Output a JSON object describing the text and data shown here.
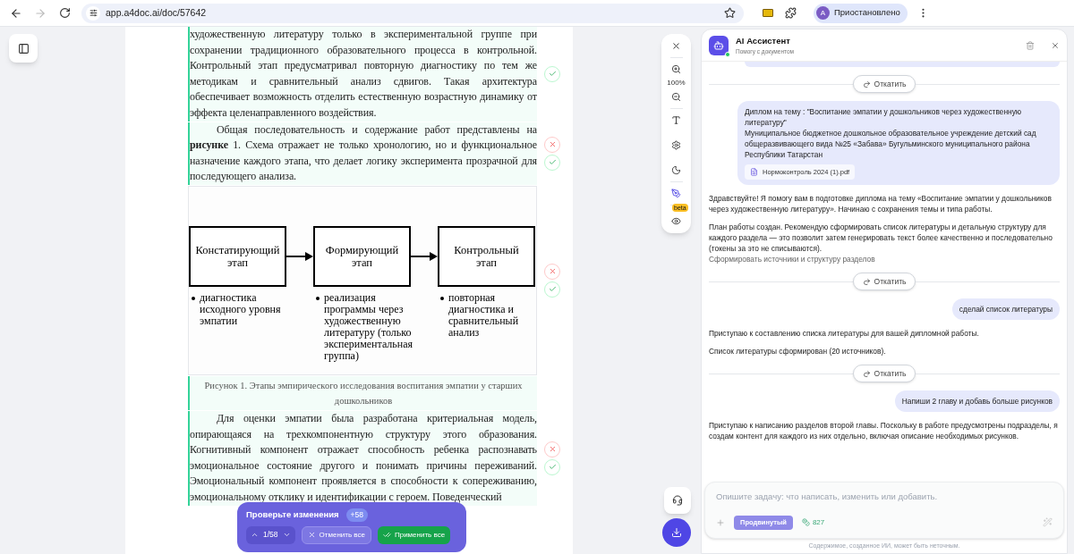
{
  "browser": {
    "forward_disabled": true,
    "url": "app.a4doc.ai/doc/57642",
    "profile_initial": "А",
    "profile_label": "Приостановлено"
  },
  "document": {
    "blocks": [
      {
        "kind": "paragraph",
        "changed": true,
        "indent": false,
        "show_reject": false,
        "show_accept": true,
        "text": "художественную литературу только в экспериментальной группе при сохранении традиционного образовательного процесса в контрольной. Контрольный этап предусматривал повторную диагностику по тем же методикам и сравнительный анализ сдвигов. Такая архитектура обеспечивает возможность отделить естественную возрастную динамику от эффекта целенаправленного воздействия."
      },
      {
        "kind": "paragraph",
        "changed": true,
        "indent": true,
        "show_reject": true,
        "show_accept": true,
        "text": "Общая последовательность и содержание работ представлены на **рисунке** 1. Схема отражает не только хронологию, но и функциональное назначение каждого этапа, что делает логику эксперимента прозрачной для последующего анализа."
      },
      {
        "kind": "figure",
        "changed": false,
        "show_reject": true,
        "show_accept": true,
        "stages": [
          {
            "title": "Констатирующий этап",
            "bullet": "диагностика исходного уровня эмпатии"
          },
          {
            "title": "Формирующий этап",
            "bullet": "реализация программы через художественную литературу (только экспериментальная группа)"
          },
          {
            "title": "Контрольный этап",
            "bullet": "повторная диагностика и сравнительный анализ"
          }
        ]
      },
      {
        "kind": "caption",
        "changed": true,
        "text": "Рисунок 1. Этапы эмпирического исследования воспитания эмпатии у старших дошкольников"
      },
      {
        "kind": "paragraph",
        "changed": true,
        "indent": true,
        "show_reject": true,
        "show_accept": true,
        "text": "Для оценки эмпатии была разработана критериальная модель, опирающаяся на трехкомпонентную структуру этого образования. Когнитивный компонент отражает способность ребенка распознавать эмоциональное состояние другого и понимать причины переживаний. Эмоциональный компонент проявляется в способности к сопереживанию, эмоциональному отклику и идентификации с героем. Поведенческий"
      }
    ]
  },
  "review": {
    "title": "Проверьте изменения",
    "count": "+58",
    "position": "1/58",
    "reject_all": "Отменить все",
    "apply_all": "Применить все"
  },
  "toolbar": {
    "zoom": "100%",
    "beta_badge": "beta",
    "annotate_active": true
  },
  "chat": {
    "title": "AI Ассистент",
    "subtitle": "Помогу с документом",
    "online": true,
    "messages": [
      {
        "kind": "bubble_edge"
      },
      {
        "kind": "rollback",
        "label": "Откатить"
      },
      {
        "kind": "user",
        "lines": [
          "Диплом на тему : \"Воспитание эмпатии у дошкольников через художественную литературу\"",
          "Муниципальное бюджетное дошкольное образовательное учреждение детский сад общеразвивающего вида №25 «Забава» Бугульминского муниципального района Республики Татарстан"
        ],
        "attachment": "Нормоконтроль 2024 (1).pdf"
      },
      {
        "kind": "assistant",
        "paragraphs": [
          "Здравствуйте! Я помогу вам в подготовке диплома на тему «Воспитание эмпатии у дошкольников через художественную литературу». Начинаю с сохранения темы и типа работы.",
          "План работы создан. Рекомендую сформировать список литературы и детальную структуру для каждого раздела — это позволит затем генерировать текст более качественно и последовательно (токены за это не списываются)."
        ],
        "link": "Сформировать источники и структуру разделов"
      },
      {
        "kind": "rollback",
        "label": "Откатить"
      },
      {
        "kind": "user",
        "lines": [
          "сделай список литературы"
        ]
      },
      {
        "kind": "assistant",
        "paragraphs": [
          "Приступаю к составлению списка литературы для вашей дипломной работы.",
          "Список литературы сформирован (20 источников)."
        ]
      },
      {
        "kind": "rollback",
        "label": "Откатить"
      },
      {
        "kind": "user",
        "lines": [
          "Напиши 2 главу и добавь больше рисунков"
        ]
      },
      {
        "kind": "assistant",
        "paragraphs": [
          "Приступаю к написанию разделов второй главы. Поскольку в работе предусмотрены подразделы, я создам контент для каждого из них отдельно, включая описание необходимых рисунков."
        ]
      }
    ],
    "input": {
      "placeholder": "Опишите задачу: что написать, изменить или добавить.",
      "mode": "Продвинутый",
      "tokens": "827"
    },
    "disclaimer": "Содержимое, созданное ИИ, может быть неточным."
  }
}
